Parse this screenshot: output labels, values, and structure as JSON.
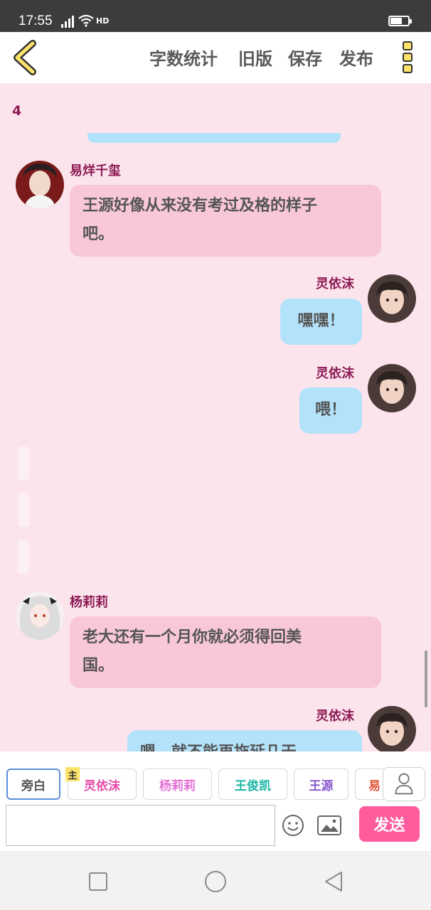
{
  "status_bar": {
    "time": "17:55",
    "network": "4G",
    "hd": "HD"
  },
  "toolbar": {
    "back_icon": "chevron-left-icon",
    "word_count": "字数统计",
    "old_version": "旧版",
    "save": "保存",
    "publish": "发布",
    "more_icon": "more-vertical-icon"
  },
  "chat": {
    "partial_number": "4",
    "messages": [
      {
        "side": "left",
        "name": "易烊千玺",
        "text_line1": "王源好像从来没有考过及格的样子",
        "text_line2": "吧。"
      },
      {
        "side": "right",
        "name": "灵依沫",
        "text": "嘿嘿！"
      },
      {
        "side": "right",
        "name": "灵依沫",
        "text": "喂！"
      },
      {
        "side": "left",
        "name": "杨莉莉",
        "text_line1": "老大还有一个月你就必须得回美",
        "text_line2": "国。"
      },
      {
        "side": "right",
        "name": "灵依沫",
        "text": "嗯，就不能再拖延几天"
      }
    ]
  },
  "characters": {
    "protagonist_badge": "主",
    "items": [
      {
        "label": "旁白",
        "color": "#555555"
      },
      {
        "label": "灵依沫",
        "color": "#e54aa8"
      },
      {
        "label": "杨莉莉",
        "color": "#e56fd6"
      },
      {
        "label": "王俊凯",
        "color": "#1ab5a5"
      },
      {
        "label": "王源",
        "color": "#8a5ad0"
      },
      {
        "label": "易",
        "color": "#e0553a"
      }
    ]
  },
  "input": {
    "placeholder": "",
    "value": "",
    "send_label": "发送"
  },
  "colors": {
    "accent": "#ff5c9e",
    "name_color": "#8c1b55",
    "left_bubble": "#f9c8d6",
    "right_bubble": "#b3e2fb"
  }
}
